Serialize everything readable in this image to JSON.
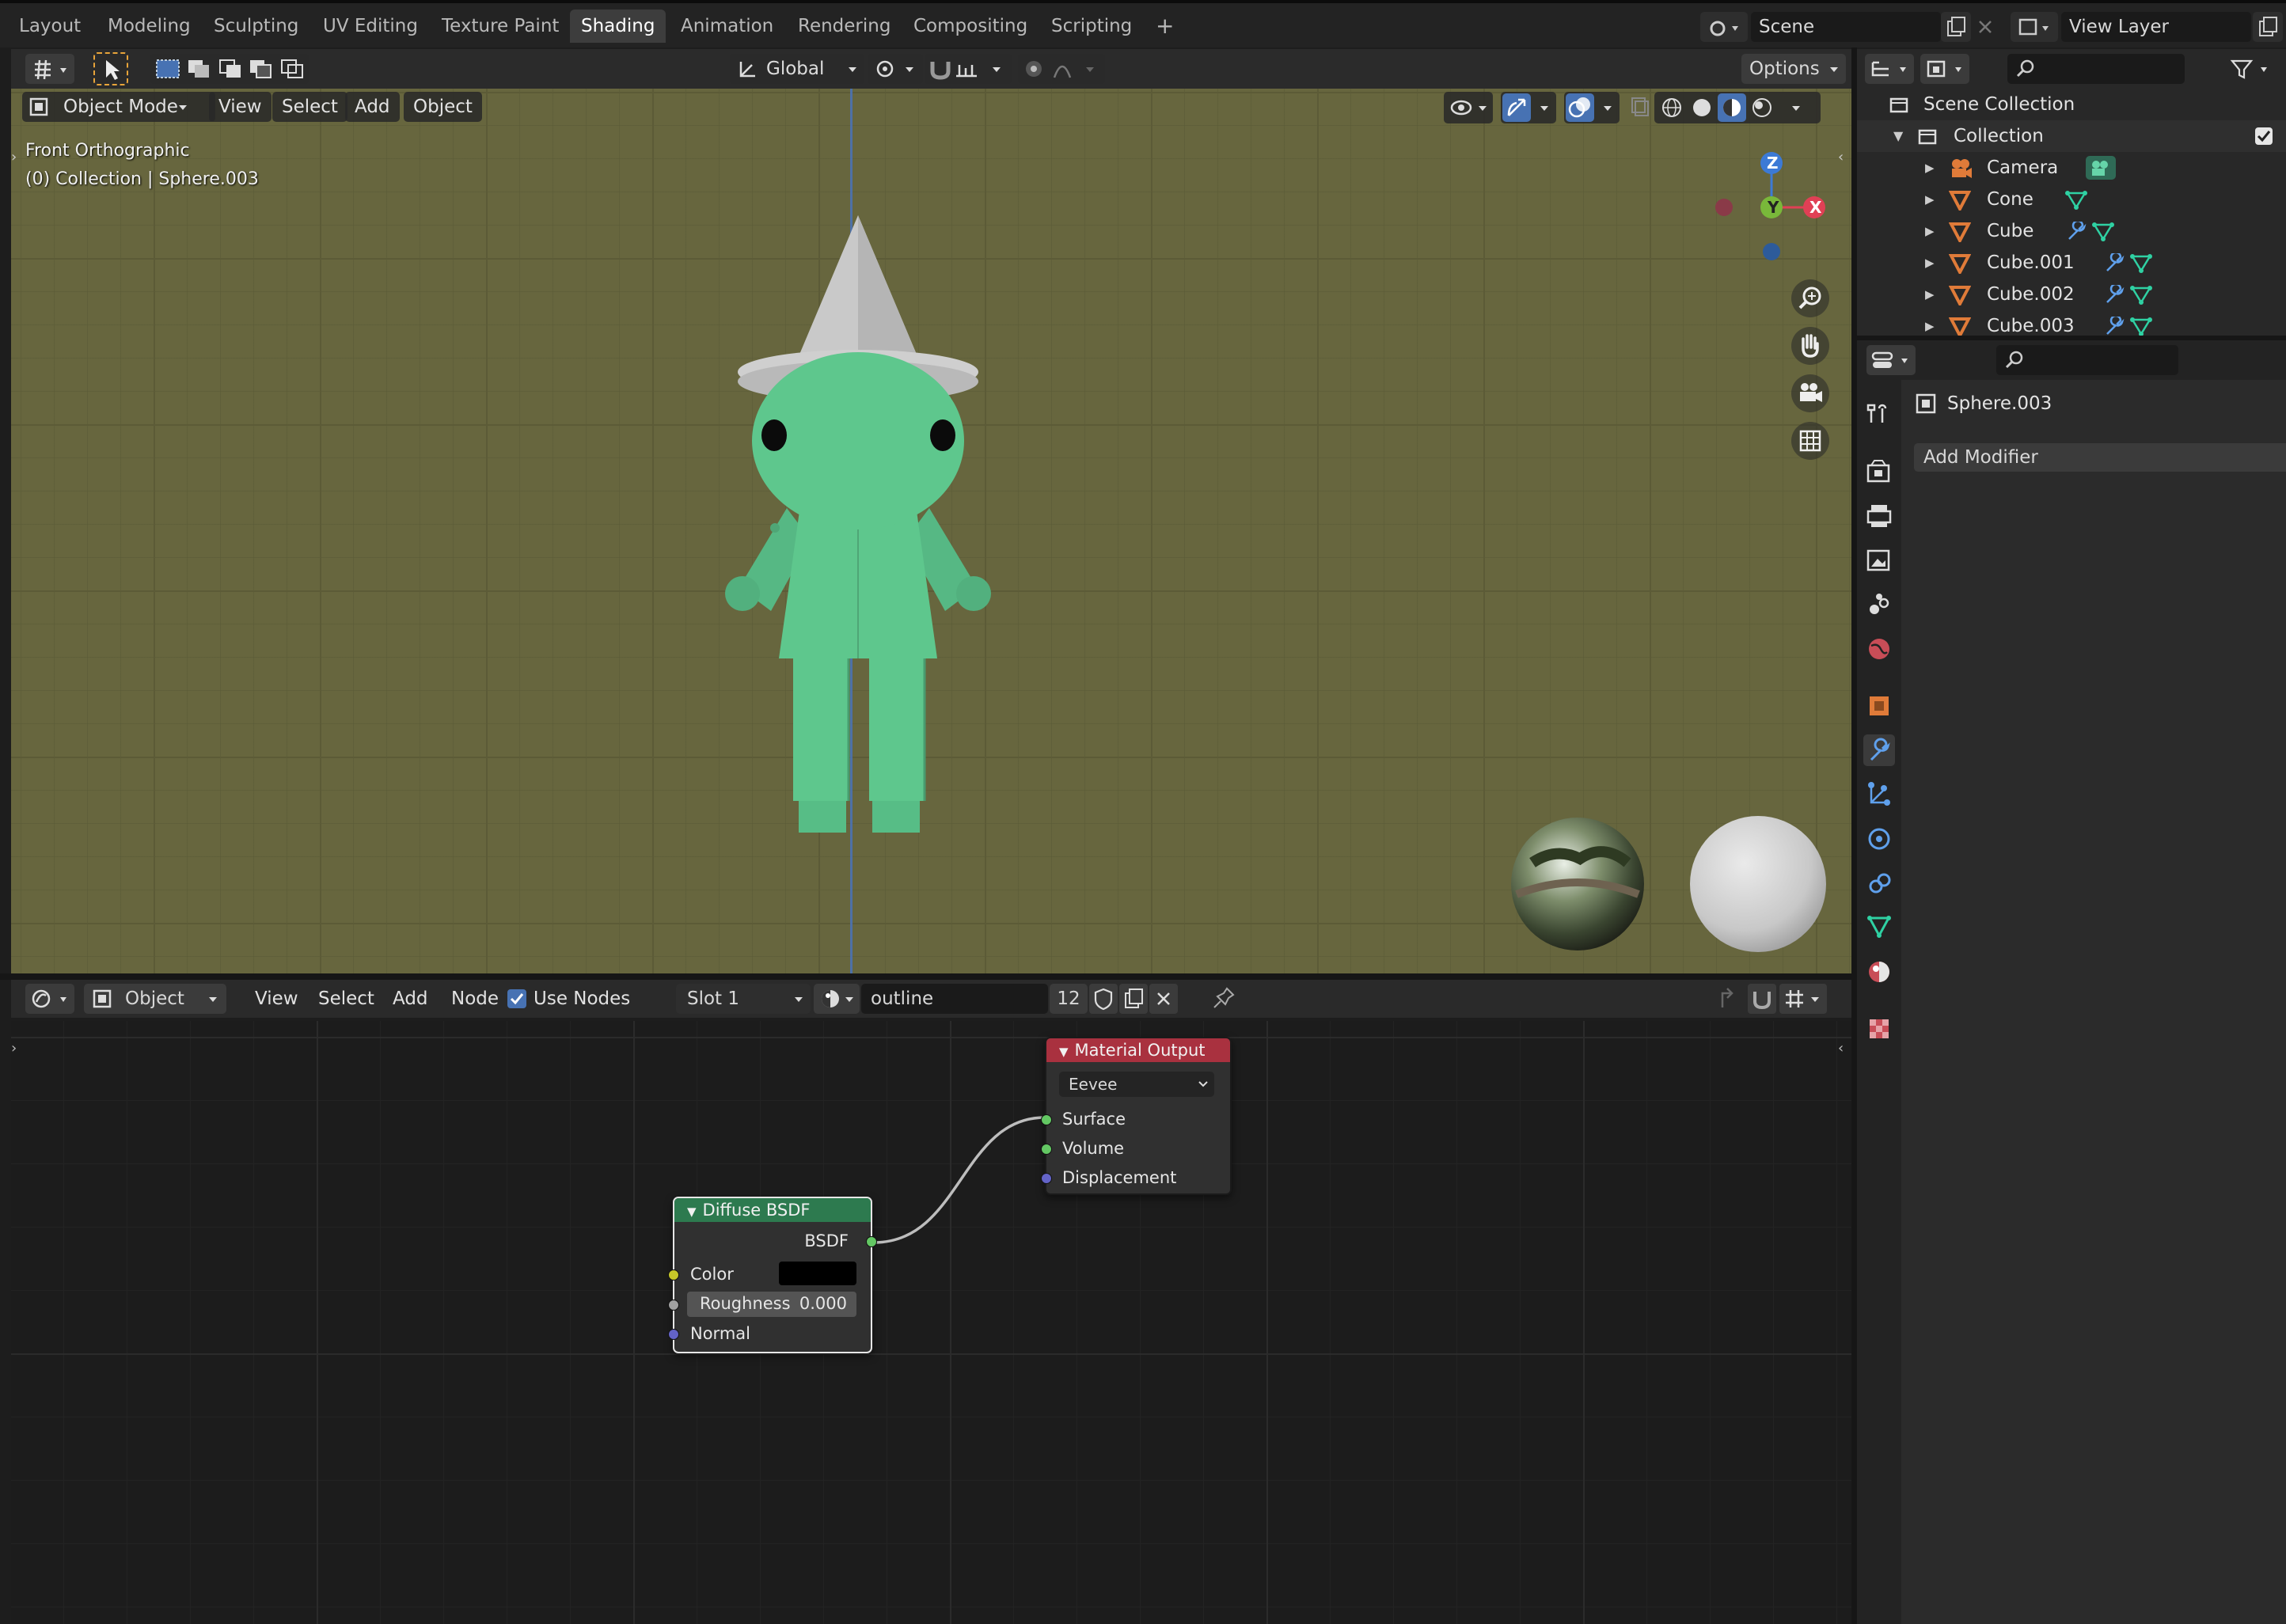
{
  "workspace_tabs": [
    {
      "label": "Layout"
    },
    {
      "label": "Modeling"
    },
    {
      "label": "Sculpting"
    },
    {
      "label": "UV Editing"
    },
    {
      "label": "Texture Paint"
    },
    {
      "label": "Shading",
      "active": true
    },
    {
      "label": "Animation"
    },
    {
      "label": "Rendering"
    },
    {
      "label": "Compositing"
    },
    {
      "label": "Scripting"
    }
  ],
  "top_right": {
    "scene": "Scene",
    "view_layer": "View Layer"
  },
  "viewport": {
    "header": {
      "mode": "Object Mode",
      "menus": [
        "View",
        "Select",
        "Add",
        "Object"
      ],
      "orientation": "Global",
      "options": "Options"
    },
    "overlay_text": {
      "view_name": "Front Orthographic",
      "collection_info": "(0) Collection | Sphere.003"
    },
    "gizmo": {
      "z": "Z",
      "y": "Y",
      "x": "X"
    }
  },
  "node_editor": {
    "header": {
      "object": "Object",
      "menus": [
        "View",
        "Select",
        "Add",
        "Node"
      ],
      "use_nodes_label": "Use Nodes",
      "use_nodes_checked": true,
      "slot": "Slot 1",
      "material_name": "outline",
      "user_count": "12"
    },
    "nodes": {
      "material_output": {
        "title": "Material Output",
        "target": "Eevee",
        "inputs": [
          "Surface",
          "Volume",
          "Displacement"
        ],
        "header_color": "#a9313f"
      },
      "diffuse_bsdf": {
        "title": "Diffuse BSDF",
        "output": "BSDF",
        "color_label": "Color",
        "color_value": "#000000",
        "roughness_label": "Roughness",
        "roughness_value": "0.000",
        "normal_label": "Normal",
        "header_color": "#2d7a4f"
      }
    }
  },
  "outliner": {
    "root": "Scene Collection",
    "collection": "Collection",
    "objects": [
      {
        "name": "Camera",
        "icon": "camera-icon"
      },
      {
        "name": "Cone",
        "icon": "mesh-icon"
      },
      {
        "name": "Cube",
        "icon": "mesh-icon"
      },
      {
        "name": "Cube.001",
        "icon": "mesh-icon"
      },
      {
        "name": "Cube.002",
        "icon": "mesh-icon"
      },
      {
        "name": "Cube.003",
        "icon": "mesh-icon"
      }
    ]
  },
  "properties": {
    "object_name": "Sphere.003",
    "add_modifier": "Add Modifier",
    "active_tab": "modifier"
  },
  "colors": {
    "accent": "#4772b3",
    "mesh_green": "#5ec78d",
    "viewport_bg": "#67663e"
  }
}
